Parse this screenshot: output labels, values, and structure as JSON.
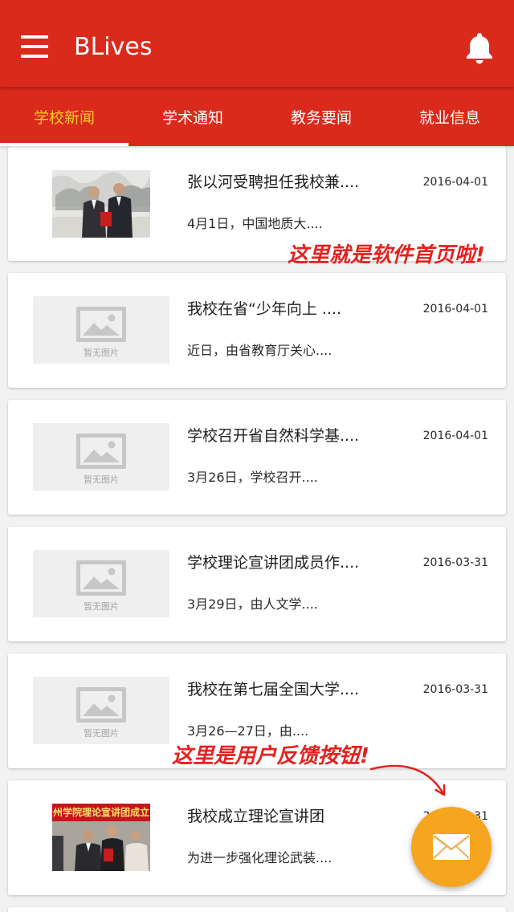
{
  "app_bar": {
    "title": "BLives",
    "menu_icon": "menu-icon",
    "notification_icon": "bell-icon"
  },
  "tabs": [
    {
      "label": "学校新闻",
      "active": true
    },
    {
      "label": "学术通知",
      "active": false
    },
    {
      "label": "教务要闻",
      "active": false
    },
    {
      "label": "就业信息",
      "active": false
    }
  ],
  "news_list": {
    "placeholder_label": "暂无图片",
    "placeholder_icon": "image-icon",
    "items": [
      {
        "title": "张以河受聘担任我校兼....",
        "date": "2016-04-01",
        "summary": "4月1日，中国地质大...."
      },
      {
        "title": "我校在省“少年向上 ....",
        "date": "2016-04-01",
        "summary": "近日，由省教育厅关心...."
      },
      {
        "title": "学校召开省自然科学基....",
        "date": "2016-04-01",
        "summary": "3月26日，学校召开...."
      },
      {
        "title": "学校理论宣讲团成员作....",
        "date": "2016-03-31",
        "summary": "3月29日，由人文学...."
      },
      {
        "title": "我校在第七届全国大学....",
        "date": "2016-03-31",
        "summary": "3月26—27日，由...."
      },
      {
        "title": "我校成立理论宣讲团",
        "date": "2016-03-31",
        "summary": "为进一步强化理论武装....",
        "photo_banner": "州学院理论宣讲团成立"
      }
    ]
  },
  "annotations": {
    "home_note": "这里就是软件首页啦!",
    "feedback_note": "这里是用户反馈按钮!"
  },
  "fab": {
    "icon": "mail-icon"
  },
  "colors": {
    "primary": "#da2a1c",
    "active_tab": "#ffc928",
    "tab_indicator": "#ffffff",
    "fab": "#f6a51f",
    "annotation": "#e3221f",
    "placeholder_bg": "#efefef"
  }
}
